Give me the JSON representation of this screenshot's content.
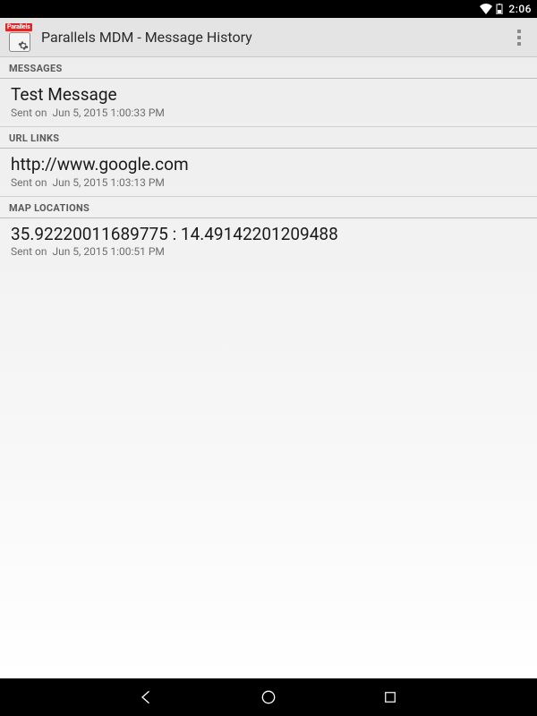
{
  "status": {
    "time": "2:06"
  },
  "app": {
    "icon_badge": "Parallels",
    "title": "Parallels MDM - Message History"
  },
  "sections": {
    "messages": {
      "header": "MESSAGES",
      "item": {
        "title": "Test Message",
        "sent_prefix": "Sent on",
        "sent_at": "Jun 5, 2015 1:00:33 PM"
      }
    },
    "urls": {
      "header": "URL LINKS",
      "item": {
        "title": "http://www.google.com",
        "sent_prefix": "Sent on",
        "sent_at": "Jun 5, 2015 1:03:13 PM"
      }
    },
    "maps": {
      "header": "MAP LOCATIONS",
      "item": {
        "title": "35.92220011689775 : 14.49142201209488",
        "sent_prefix": "Sent on",
        "sent_at": "Jun 5, 2015 1:00:51 PM"
      }
    }
  }
}
